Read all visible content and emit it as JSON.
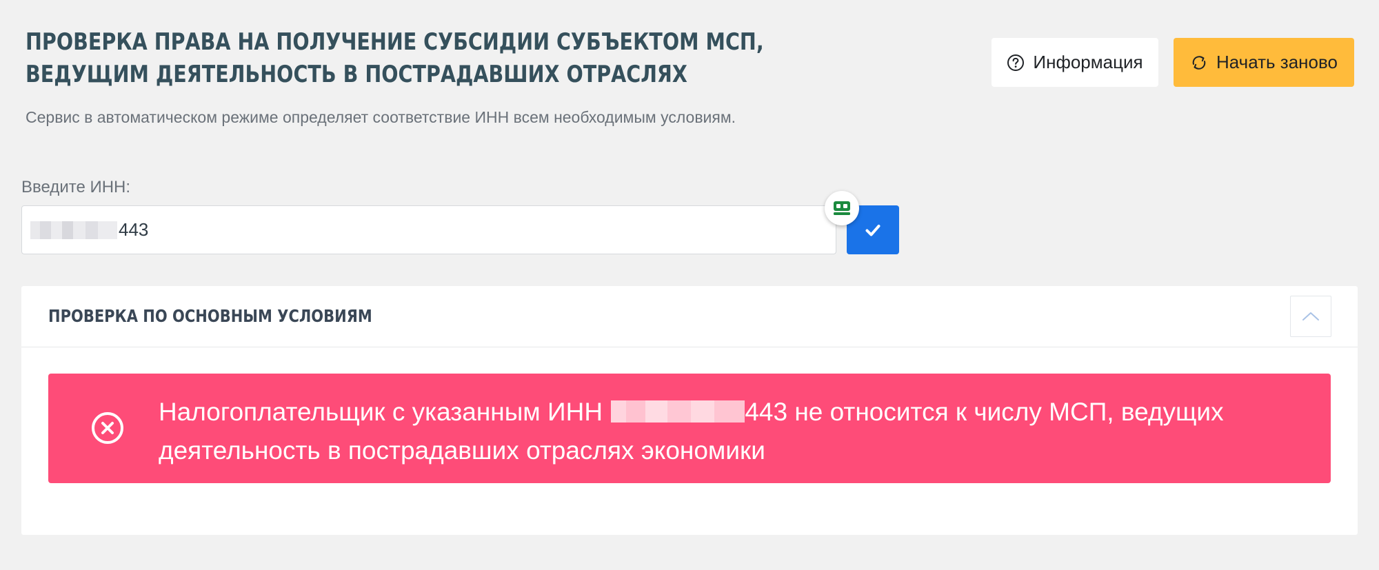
{
  "header": {
    "title": "ПРОВЕРКА ПРАВА НА ПОЛУЧЕНИЕ СУБСИДИИ СУБЪЕКТОМ МСП, ВЕДУЩИМ ДЕЯТЕЛЬНОСТЬ В ПОСТРАДАВШИХ ОТРАСЛЯХ",
    "subtitle": "Сервис в автоматическом режиме определяет соответствие ИНН всем необходимым условиям.",
    "info_button": {
      "label": "Информация",
      "icon": "question-circle-icon"
    },
    "restart_button": {
      "label": "Начать заново",
      "icon": "refresh-icon",
      "color": "#ffbb3b"
    }
  },
  "inn_form": {
    "label": "Введите ИНН:",
    "value_visible_suffix": "443",
    "submit_icon": "checkmark-icon",
    "submit_color": "#1a73e8",
    "extension_icon": "password-manager-icon"
  },
  "check_section": {
    "title": "ПРОВЕРКА ПО ОСНОВНЫМ УСЛОВИЯМ",
    "collapse_icon": "chevron-up-icon",
    "alert": {
      "icon": "close-circle-icon",
      "color": "#fe4c78",
      "text_before": "Налогоплательщик с указанным ИНН",
      "text_after": "443 не относится к числу МСП, ведущих деятельность в пострадавших отраслях экономики"
    }
  }
}
